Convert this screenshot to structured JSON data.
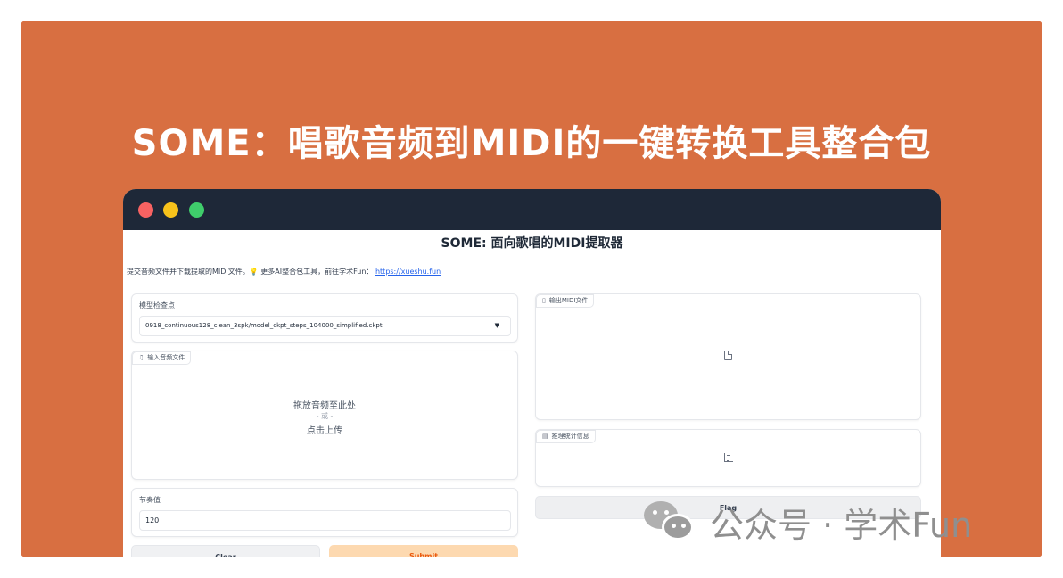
{
  "banner": {
    "title": "SOME：唱歌音频到MIDI的一键转换工具整合包",
    "background": "#d86f41"
  },
  "window_controls": [
    "close",
    "minimize",
    "maximize"
  ],
  "app": {
    "title": "SOME: 面向歌唱的MIDI提取器",
    "description": "提交音频文件并下载提取的MIDI文件。💡 更多AI整合包工具，前往学术Fun：",
    "link": "https://xueshu.fun",
    "checkpoint": {
      "label": "模型检查点",
      "value": "0918_continuous128_clean_3spk/model_ckpt_steps_104000_simplified.ckpt"
    },
    "audio_input": {
      "label": "输入音频文件",
      "drop_text": "拖放音频至此处",
      "or_text": "- 或 -",
      "upload_text": "点击上传"
    },
    "tempo": {
      "label": "节奏值",
      "value": "120"
    },
    "buttons": {
      "clear": "Clear",
      "submit": "Submit",
      "flag": "Flag"
    },
    "midi_output": {
      "label": "输出MIDI文件"
    },
    "stats": {
      "label": "推理统计信息"
    }
  },
  "watermark": {
    "text": "公众号 · 学术Fun"
  }
}
